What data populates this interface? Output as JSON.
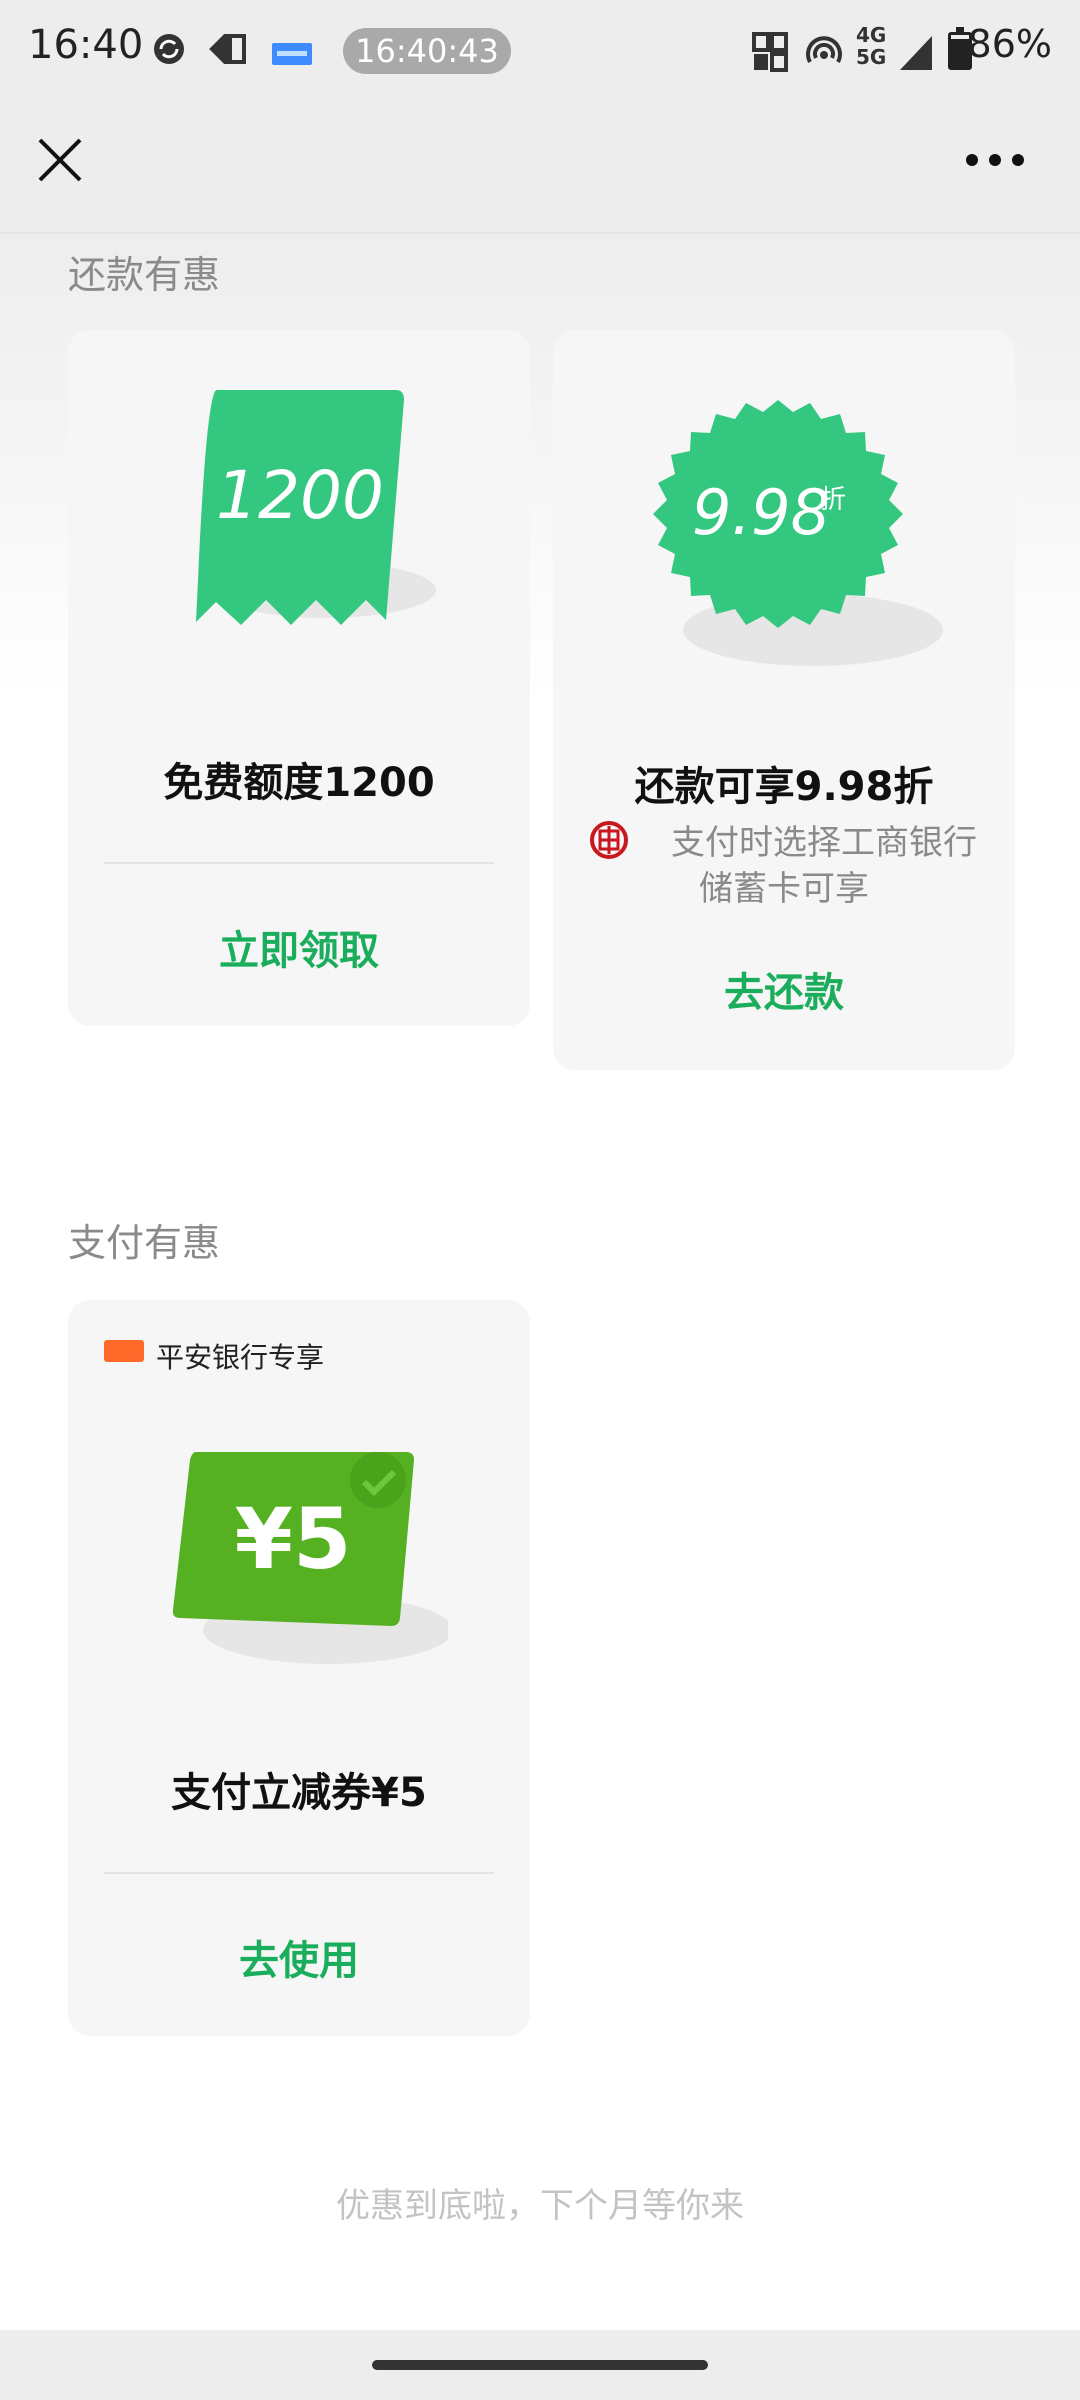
{
  "status_bar": {
    "time": "16:40",
    "clock_pill": "16:40:43",
    "network": "4G+ 5G",
    "battery": "86%"
  },
  "nav": {
    "close_icon": "close-icon",
    "more_icon": "more-icon"
  },
  "repay_section": {
    "title": "还款有惠",
    "cards": [
      {
        "illustration_value": "1200",
        "title": "免费额度1200",
        "action": "立即领取"
      },
      {
        "illustration_value": "9.98",
        "illustration_unit": "折",
        "title": "还款可享9.98折",
        "subtitle_line1": "支付时选择工商银行",
        "subtitle_line2": "储蓄卡可享",
        "action": "去还款"
      }
    ]
  },
  "pay_section": {
    "title": "支付有惠",
    "cards": [
      {
        "bank_label": "平安银行专享",
        "illustration_value": "¥5",
        "title": "支付立减券¥5",
        "action": "去使用"
      }
    ]
  },
  "footer": {
    "note": "优惠到底啦，下个月等你来"
  },
  "colors": {
    "accent_green": "#1aad5b",
    "coupon_green": "#34c77f",
    "voucher_green": "#55b121",
    "icbc_red": "#c9171e"
  }
}
